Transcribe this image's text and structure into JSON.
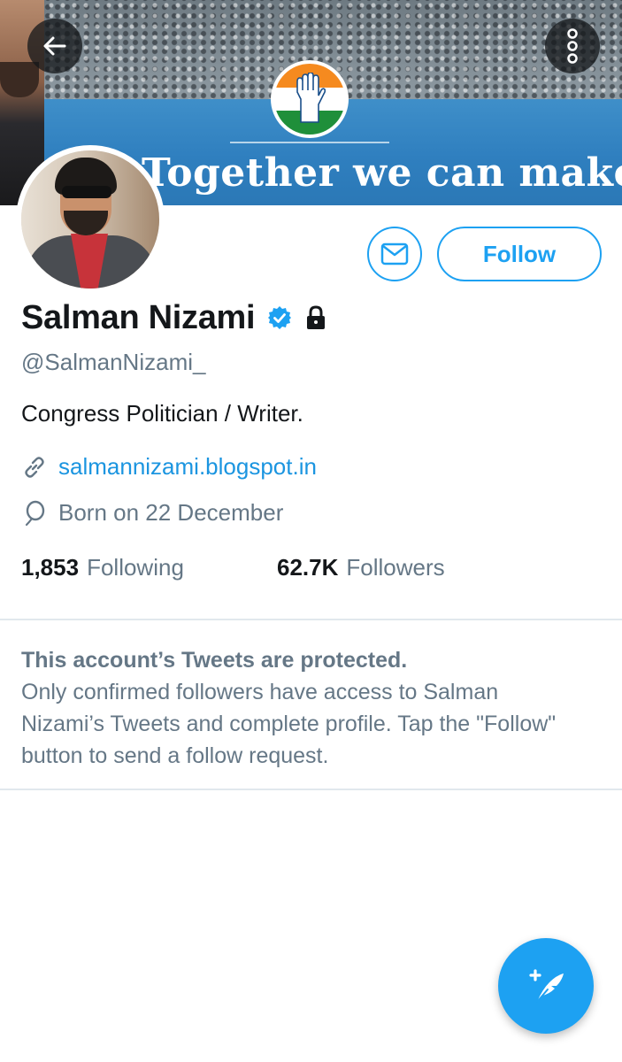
{
  "banner": {
    "slogan": "Together we can make a dif",
    "accent_color": "#2f7fbf"
  },
  "header": {
    "back_icon": "arrow-left-icon",
    "more_icon": "more-vertical-icon"
  },
  "profile": {
    "name": "Salman Nizami",
    "handle": "@SalmanNizami_",
    "bio": "Congress Politician / Writer.",
    "website": "salmannizami.blogspot.in",
    "birthday": "Born on 22 December",
    "verified": true,
    "protected": true
  },
  "actions": {
    "message_icon": "envelope-icon",
    "follow_label": "Follow"
  },
  "stats": {
    "following_count": "1,853",
    "following_label": "Following",
    "followers_count": "62.7K",
    "followers_label": "Followers"
  },
  "protected_notice": {
    "title": "This account’s Tweets are protected.",
    "body": "Only confirmed followers have access to Salman Nizami’s Tweets and complete profile. Tap the \"Follow\" button to send a follow request."
  },
  "fab": {
    "icon": "compose-tweet-icon"
  },
  "colors": {
    "brand": "#1da1f2",
    "secondary_text": "#657786",
    "link": "#1b95e0"
  }
}
